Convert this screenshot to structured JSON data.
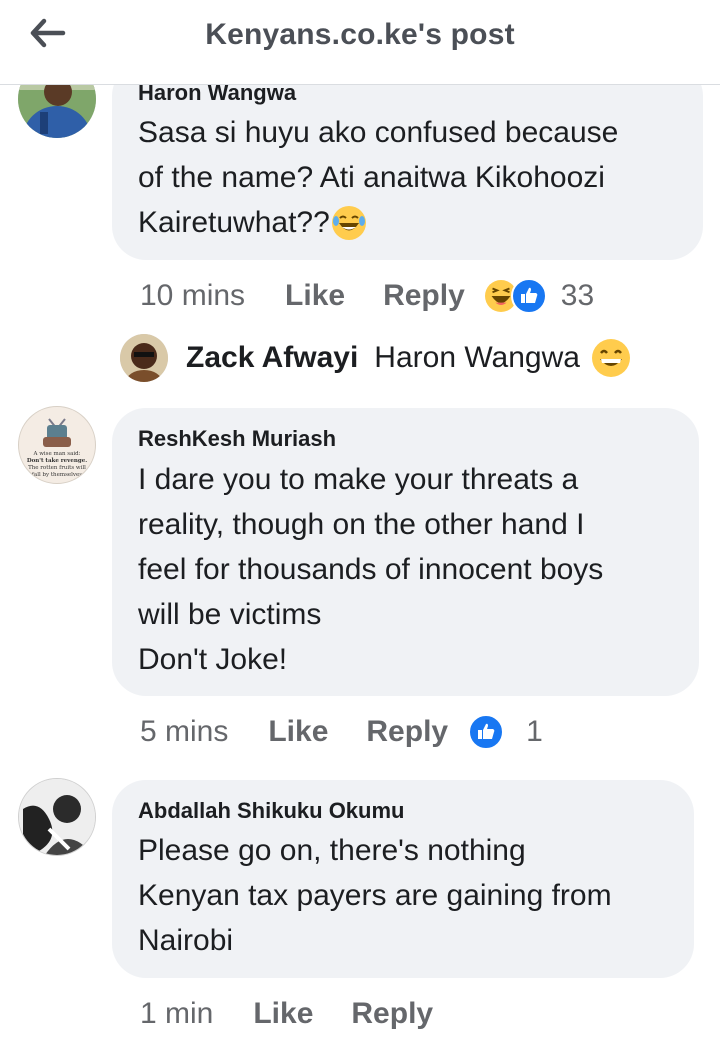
{
  "header": {
    "title": "Kenyans.co.ke's post",
    "back_icon": "back-arrow-icon"
  },
  "comments": [
    {
      "author": "Haron Wangwa",
      "lines": [
        "Sasa si huyu ako confused because",
        "of the name? Ati anaitwa Kikohoozi",
        "Kairetuwhat??"
      ],
      "time": "10 mins",
      "like": "Like",
      "reply": "Reply",
      "reaction_count": "33",
      "reactions": [
        "laugh-emoji-icon",
        "like-icon"
      ]
    },
    {
      "author": "ReshKesh Muriash",
      "avatar_text": [
        "A wise man said:",
        "Don't take revenge.",
        "The rotten fruits will",
        "fall by themselves"
      ],
      "lines": [
        "I dare you to make your threats a",
        "reality, though on the other hand I",
        "feel for thousands of innocent boys",
        "will be victims",
        "Don't Joke!"
      ],
      "time": "5 mins",
      "like": "Like",
      "reply": "Reply",
      "reaction_count": "1",
      "reactions": [
        "like-icon"
      ]
    },
    {
      "author": "Abdallah Shikuku Okumu",
      "lines": [
        "Please go on, there's nothing",
        "Kenyan tax payers are gaining from",
        "Nairobi"
      ],
      "time": "1 min",
      "like": "Like",
      "reply": "Reply"
    }
  ],
  "reply_preview": {
    "author": "Zack Afwayi",
    "text": "Haron Wangwa",
    "emoji": "grinning-emoji-icon"
  },
  "colors": {
    "bubble": "#f0f2f5",
    "meta_text": "#65676b",
    "like_blue": "#1877f2",
    "emoji_yellow": "#ffcc4d"
  }
}
